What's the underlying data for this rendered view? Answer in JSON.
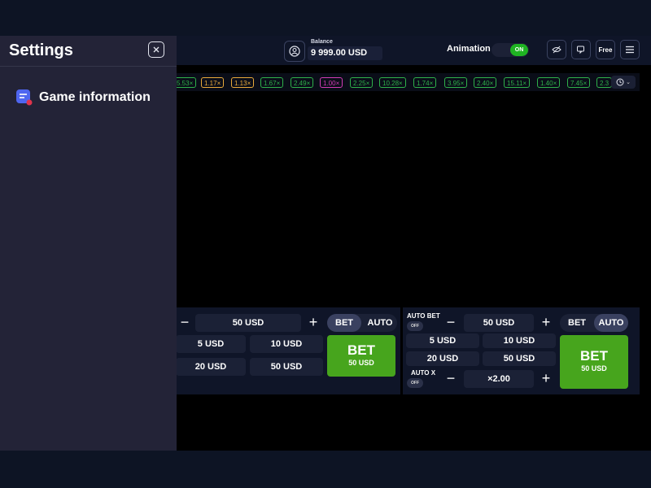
{
  "header": {
    "balance_label": "Balance",
    "balance_value": "9 999.00 USD",
    "animation_label": "Animation",
    "animation_toggle": "ON",
    "free_label": "Free"
  },
  "multipliers": [
    {
      "text": "5.53×",
      "color": "#2fb14a"
    },
    {
      "text": "1.17×",
      "color": "#e9a93a"
    },
    {
      "text": "1.13×",
      "color": "#e9a93a"
    },
    {
      "text": "1.67×",
      "color": "#2fb14a"
    },
    {
      "text": "2.49×",
      "color": "#2fb14a"
    },
    {
      "text": "1.00×",
      "color": "#d23cb5"
    },
    {
      "text": "2.25×",
      "color": "#2fb14a"
    },
    {
      "text": "10.28×",
      "color": "#2fb14a"
    },
    {
      "text": "1.74×",
      "color": "#2fb14a"
    },
    {
      "text": "3.95×",
      "color": "#2fb14a"
    },
    {
      "text": "2.40×",
      "color": "#2fb14a"
    },
    {
      "text": "15.11×",
      "color": "#2fb14a"
    },
    {
      "text": "1.40×",
      "color": "#2fb14a"
    },
    {
      "text": "7.45×",
      "color": "#2fb14a"
    },
    {
      "text": "2.3",
      "color": "#2fb14a"
    }
  ],
  "panel1": {
    "amount": "50 USD",
    "minus": "−",
    "plus": "+",
    "tab_bet": "BET",
    "tab_auto": "AUTO",
    "quick": [
      "5 USD",
      "10 USD",
      "20 USD",
      "50 USD"
    ],
    "bet_label": "BET",
    "bet_amount": "50 USD"
  },
  "panel2": {
    "auto_bet_label": "AUTO BET",
    "auto_bet_toggle": "OFF",
    "amount": "50 USD",
    "minus": "−",
    "plus": "+",
    "tab_bet": "BET",
    "tab_auto": "AUTO",
    "quick": [
      "5 USD",
      "10 USD",
      "20 USD",
      "50 USD"
    ],
    "auto_x_label": "AUTO X",
    "auto_x_toggle": "OFF",
    "auto_x_value": "×2.00",
    "bet_label": "BET",
    "bet_amount": "50 USD"
  },
  "settings": {
    "title": "Settings",
    "items": [
      {
        "label": "Game information",
        "icon": "game-info-icon"
      }
    ]
  },
  "colors": {
    "accent_green": "#47a51d",
    "toggle_green": "#1fb322",
    "sidebar_bg": "#232337",
    "header_bg": "#0f1528"
  }
}
